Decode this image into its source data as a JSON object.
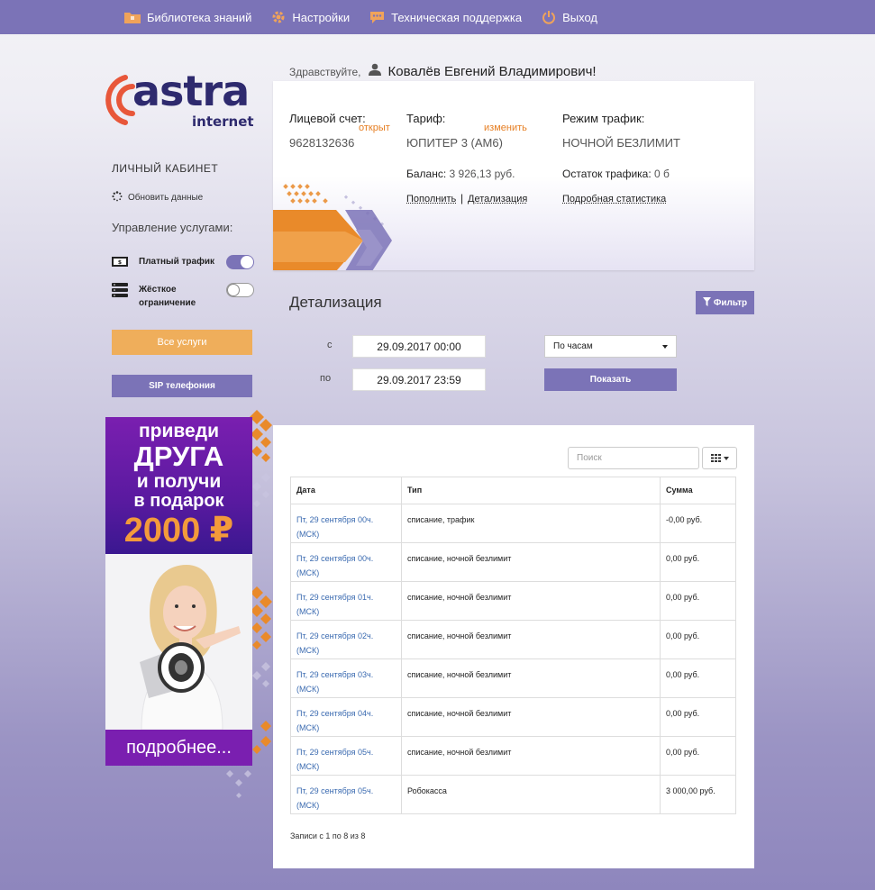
{
  "nav": {
    "items": [
      {
        "label": "Библиотека знаний",
        "icon": "folder-icon"
      },
      {
        "label": "Настройки",
        "icon": "gear-icon"
      },
      {
        "label": "Техническая поддержка",
        "icon": "chat-icon"
      },
      {
        "label": "Выход",
        "icon": "power-icon"
      }
    ]
  },
  "brand": {
    "logo_word": "astra",
    "logo_sub": "internet"
  },
  "sidebar": {
    "title": "ЛИЧНЫЙ КАБИНЕТ",
    "refresh_label": "Обновить данные",
    "services_title": "Управление услугами:",
    "paid_traffic": {
      "label": "Платный трафик",
      "on": true
    },
    "hard_limit": {
      "label": "Жёсткое ограничение",
      "on": false
    },
    "all_services_label": "Все услуги",
    "sip_label": "SIP телефония"
  },
  "banner": {
    "line1": "приведи",
    "line2": "ДРУГА",
    "line3": "и получи",
    "line4": "в подарок",
    "amount": "2000 ₽",
    "more": "подробнее..."
  },
  "greeting": {
    "hello": "Здравствуйте,",
    "name": "Ковалёв Евгений Владимирович!"
  },
  "account": {
    "account_label": "Лицевой счет:",
    "account_status": "открыт",
    "account_number": "9628132636",
    "tariff_label": "Тариф:",
    "tariff_change": "изменить",
    "tariff_name": "ЮПИТЕР 3 (АМ6)",
    "balance_label": "Баланс:",
    "balance_value": "3 926,13 руб.",
    "topup_label": "Пополнить",
    "separator": "|",
    "detail_label": "Детализация",
    "traffic_mode_label": "Режим трафик:",
    "traffic_mode_value": "НОЧНОЙ БЕЗЛИМИТ",
    "traffic_left_label": "Остаток трафика:",
    "traffic_left_value": "0 б",
    "stats_label": "Подробная статистика"
  },
  "detalization": {
    "title": "Детализация",
    "filter_label": "Фильтр",
    "from_label": "с",
    "to_label": "по",
    "from_value": "29.09.2017 00:00",
    "to_value": "29.09.2017 23:59",
    "period_select": "По часам",
    "show_label": "Показать"
  },
  "table": {
    "search_placeholder": "Поиск",
    "columns": [
      "Дата",
      "Тип",
      "Сумма"
    ],
    "rows": [
      {
        "date": "Пт, 29 сентября 00ч. (МСК)",
        "type": "списание, трафик",
        "sum": "-0,00 руб."
      },
      {
        "date": "Пт, 29 сентября 00ч. (МСК)",
        "type": "списание, ночной безлимит",
        "sum": "0,00 руб."
      },
      {
        "date": "Пт, 29 сентября 01ч. (МСК)",
        "type": "списание, ночной безлимит",
        "sum": "0,00 руб."
      },
      {
        "date": "Пт, 29 сентября 02ч. (МСК)",
        "type": "списание, ночной безлимит",
        "sum": "0,00 руб."
      },
      {
        "date": "Пт, 29 сентября 03ч. (МСК)",
        "type": "списание, ночной безлимит",
        "sum": "0,00 руб."
      },
      {
        "date": "Пт, 29 сентября 04ч. (МСК)",
        "type": "списание, ночной безлимит",
        "sum": "0,00 руб."
      },
      {
        "date": "Пт, 29 сентября 05ч. (МСК)",
        "type": "списание, ночной безлимит",
        "sum": "0,00 руб."
      },
      {
        "date": "Пт, 29 сентября 05ч. (МСК)",
        "type": "Робокасса",
        "sum": "3 000,00 руб."
      }
    ],
    "info": "Записи с 1 по 8 из 8"
  },
  "colors": {
    "accent": "#7b73b7",
    "orange": "#efae5b",
    "brand_dark": "#2e2a6e",
    "link_orange": "#e67e22",
    "banner_purple": "#7a1fb0"
  }
}
